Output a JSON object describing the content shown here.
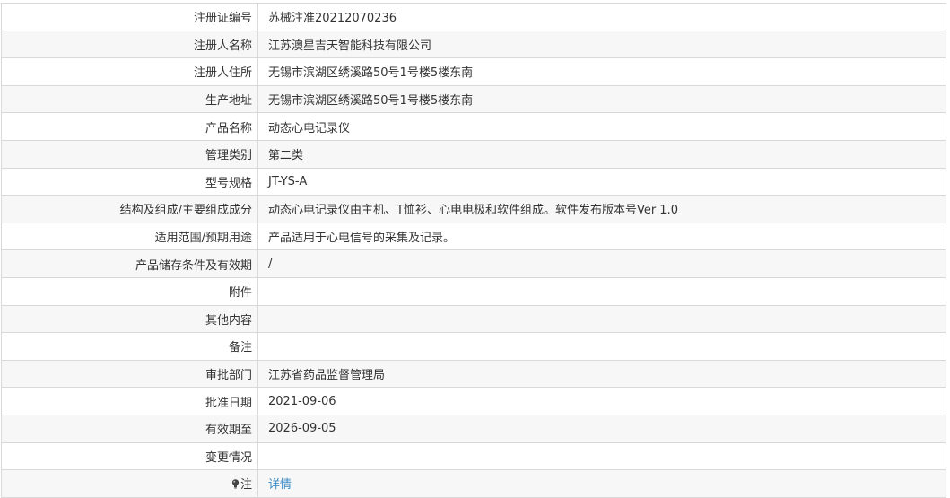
{
  "rows": [
    {
      "label": "注册证编号",
      "value": "苏械注准20212070236"
    },
    {
      "label": "注册人名称",
      "value": "江苏澳星吉天智能科技有限公司"
    },
    {
      "label": "注册人住所",
      "value": "无锡市滨湖区绣溪路50号1号楼5楼东南"
    },
    {
      "label": "生产地址",
      "value": "无锡市滨湖区绣溪路50号1号楼5楼东南"
    },
    {
      "label": "产品名称",
      "value": "动态心电记录仪"
    },
    {
      "label": "管理类别",
      "value": "第二类"
    },
    {
      "label": "型号规格",
      "value": "JT-YS-A"
    },
    {
      "label": "结构及组成/主要组成成分",
      "value": "动态心电记录仪由主机、T恤衫、心电电极和软件组成。软件发布版本号Ver 1.0"
    },
    {
      "label": "适用范围/预期用途",
      "value": "产品适用于心电信号的采集及记录。"
    },
    {
      "label": "产品储存条件及有效期",
      "value": "/"
    },
    {
      "label": "附件",
      "value": ""
    },
    {
      "label": "其他内容",
      "value": ""
    },
    {
      "label": "备注",
      "value": ""
    },
    {
      "label": "审批部门",
      "value": "江苏省药品监督管理局"
    },
    {
      "label": "批准日期",
      "value": "2021-09-06"
    },
    {
      "label": "有效期至",
      "value": "2026-09-05"
    },
    {
      "label": "变更情况",
      "value": ""
    }
  ],
  "note_row": {
    "icon": "lightbulb-icon",
    "label": "注",
    "link_text": "详情",
    "link_color": "#3c8dc6"
  }
}
